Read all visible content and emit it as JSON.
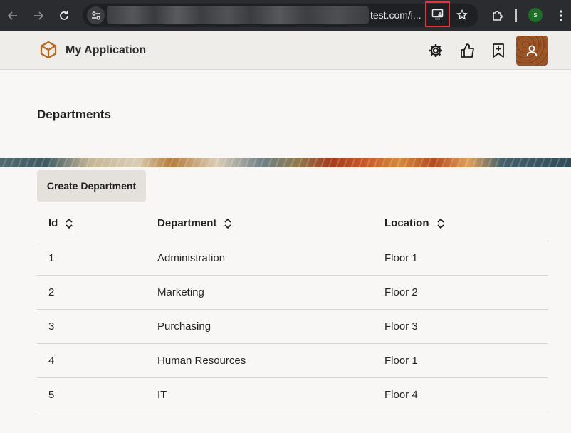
{
  "browser": {
    "url_visible": "test.com/i...",
    "profile_initial": "s"
  },
  "app": {
    "title": "My Application"
  },
  "page": {
    "title": "Departments",
    "create_button": "Create Department"
  },
  "table": {
    "headers": [
      "Id",
      "Department",
      "Location"
    ],
    "rows": [
      [
        "1",
        "Administration",
        "Floor 1"
      ],
      [
        "2",
        "Marketing",
        "Floor 2"
      ],
      [
        "3",
        "Purchasing",
        "Floor 3"
      ],
      [
        "4",
        "Human Resources",
        "Floor 1"
      ],
      [
        "5",
        "IT",
        "Floor 4"
      ]
    ]
  },
  "icons": {
    "back": "arrow-left-icon",
    "forward": "arrow-right-icon",
    "reload": "reload-icon",
    "site_info": "tune-icon",
    "install": "install-app-icon",
    "bookmark": "star-icon",
    "extensions": "puzzle-icon",
    "menu": "kebab-menu-icon",
    "logo": "cube-icon",
    "settings": "gear-icon",
    "like": "thumbs-up-icon",
    "bookmark_add": "bookmark-plus-icon",
    "user": "user-icon",
    "sort": "sort-icon"
  },
  "colors": {
    "chrome_bg": "#2b2c2f",
    "install_highlight": "#e8333a",
    "profile_green": "#1f6e2a",
    "logo_orange": "#b8671f",
    "page_bg": "#f8f7f5"
  }
}
